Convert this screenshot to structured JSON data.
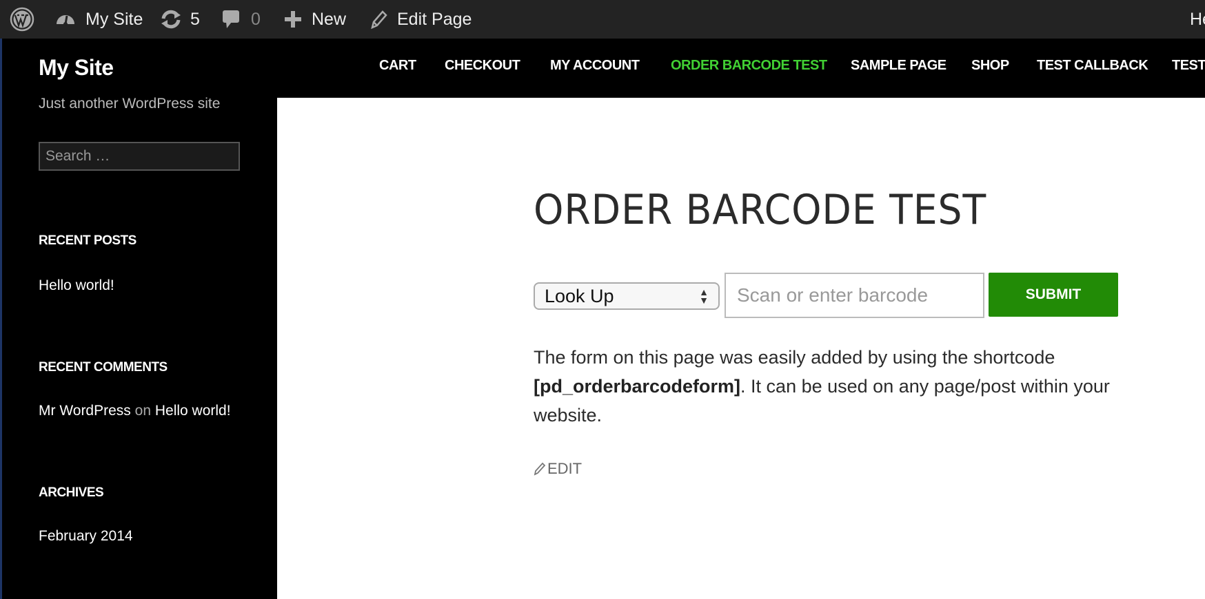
{
  "admin_bar": {
    "wp_logo": "wordpress-logo-icon",
    "site": {
      "icon": "dashboard-icon",
      "label": "My Site"
    },
    "updates": {
      "icon": "refresh-icon",
      "count": "5"
    },
    "comments": {
      "icon": "comment-icon",
      "count": "0"
    },
    "new": {
      "icon": "plus-icon",
      "label": "New"
    },
    "edit": {
      "icon": "pencil-icon",
      "label": "Edit Page"
    },
    "howdy_partial": "He"
  },
  "header": {
    "site_title": "My Site",
    "tagline": "Just another WordPress site",
    "search_placeholder": "Search …"
  },
  "nav": {
    "items": [
      {
        "label": "CART"
      },
      {
        "label": "CHECKOUT"
      },
      {
        "label": "MY ACCOUNT"
      },
      {
        "label": "ORDER BARCODE TEST",
        "active": true
      },
      {
        "label": "SAMPLE PAGE"
      },
      {
        "label": "SHOP"
      },
      {
        "label": "TEST CALLBACK"
      },
      {
        "label": "TEST"
      }
    ],
    "active_color": "#41d033"
  },
  "sidebar": {
    "recent_posts": {
      "title": "RECENT POSTS",
      "items": [
        "Hello world!"
      ]
    },
    "recent_comments": {
      "title": "RECENT COMMENTS",
      "items": [
        {
          "author": "Mr WordPress",
          "sep": "on",
          "post": "Hello world!"
        }
      ]
    },
    "archives": {
      "title": "ARCHIVES",
      "items": [
        "February 2014"
      ]
    }
  },
  "page": {
    "title": "ORDER BARCODE TEST",
    "form": {
      "select_value": "Look Up",
      "input_placeholder": "Scan or enter barcode",
      "input_value": "",
      "submit_label": "SUBMIT",
      "submit_color": "#228b06"
    },
    "description": {
      "part1": "The form on this page was easily added by using the shortcode ",
      "shortcode": "[pd_orderbarcodeform]",
      "part2": ". It can be used on any page/post within your website."
    },
    "edit_label": "EDIT"
  }
}
